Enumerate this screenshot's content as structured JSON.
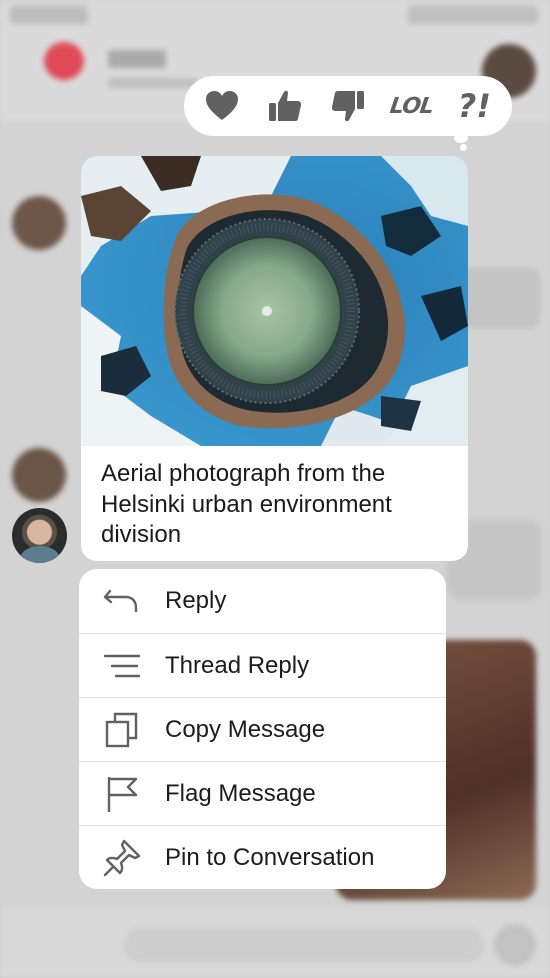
{
  "reactions": [
    {
      "name": "love",
      "icon": "heart-icon"
    },
    {
      "name": "like",
      "icon": "thumbs-up-icon"
    },
    {
      "name": "dislike",
      "icon": "thumbs-down-icon"
    },
    {
      "name": "lol",
      "icon": "lol-icon",
      "text": "LOL"
    },
    {
      "name": "wat",
      "icon": "interrobang-icon",
      "text": "?!"
    }
  ],
  "message": {
    "text": "Aerial photograph from the Helsinki urban environment division",
    "image_icon": "aerial-photo-image"
  },
  "menu": {
    "items": [
      {
        "label": "Reply",
        "icon": "reply-arrow-icon"
      },
      {
        "label": "Thread Reply",
        "icon": "thread-lines-icon"
      },
      {
        "label": "Copy Message",
        "icon": "copy-icon"
      },
      {
        "label": "Flag Message",
        "icon": "flag-icon"
      },
      {
        "label": "Pin to Conversation",
        "icon": "pin-icon"
      }
    ]
  },
  "colors": {
    "icon_gray": "#616161",
    "overlay": "#d3d3d3",
    "card": "#ffffff",
    "text": "#1a1a1a",
    "header_badge": "#e04a56"
  }
}
